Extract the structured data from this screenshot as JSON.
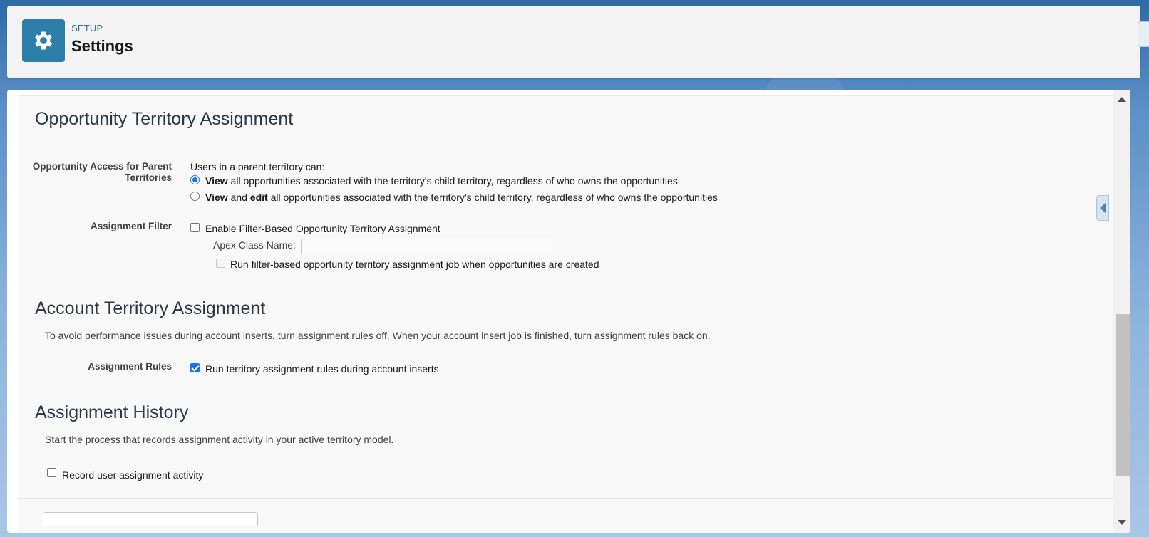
{
  "header": {
    "eyebrow": "SETUP",
    "title": "Settings",
    "icon": "gear-icon"
  },
  "opportunity_section": {
    "title": "Opportunity Territory Assignment",
    "access_label": "Opportunity Access for Parent Territories",
    "access_intro": "Users in a parent territory can:",
    "option_view": {
      "bold1": "View",
      "rest": " all opportunities associated with the territory's child territory, regardless of who owns the opportunities",
      "selected": true
    },
    "option_view_edit": {
      "bold1": "View",
      "mid": " and ",
      "bold2": "edit",
      "rest": " all opportunities associated with the territory's child territory, regardless of who owns the opportunities",
      "selected": false
    },
    "filter_label": "Assignment Filter",
    "filter_checkbox_label": "Enable Filter-Based Opportunity Territory Assignment",
    "apex_label": "Apex Class Name:",
    "apex_value": "",
    "run_filter_label": "Run filter-based opportunity territory assignment job when opportunities are created"
  },
  "account_section": {
    "title": "Account Territory Assignment",
    "description": "To avoid performance issues during account inserts, turn assignment rules off. When your account insert job is finished, turn assignment rules back on.",
    "rules_label": "Assignment Rules",
    "rules_checkbox_label": "Run territory assignment rules during account inserts",
    "rules_checked": true
  },
  "history_section": {
    "title": "Assignment History",
    "description": "Start the process that records assignment activity in your active territory model.",
    "record_label": "Record user assignment activity",
    "record_checked": false
  },
  "colors": {
    "brand": "#2d7ea8",
    "accent": "#1a73e8"
  }
}
